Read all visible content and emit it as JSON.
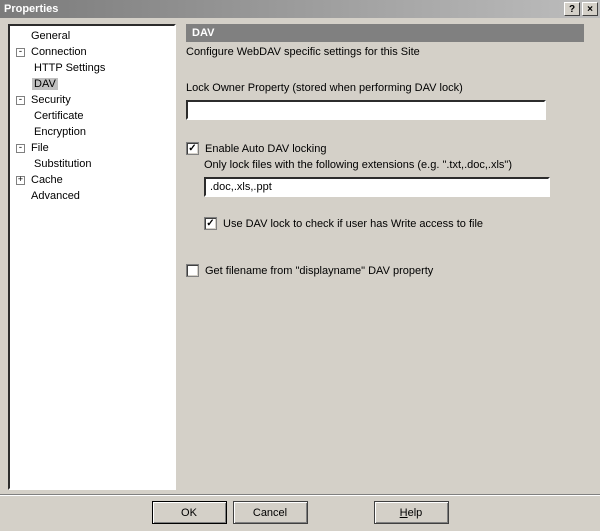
{
  "window": {
    "title": "Properties"
  },
  "tree": {
    "general": "General",
    "connection": "Connection",
    "http_settings": "HTTP Settings",
    "dav": "DAV",
    "security": "Security",
    "certificate": "Certificate",
    "encryption": "Encryption",
    "file": "File",
    "substitution": "Substitution",
    "cache": "Cache",
    "advanced": "Advanced"
  },
  "panel": {
    "header": "DAV",
    "description": "Configure WebDAV specific settings for this Site",
    "lock_owner_label": "Lock Owner Property (stored when performing DAV lock)",
    "lock_owner_value": "",
    "auto_lock_label": "Enable Auto DAV locking",
    "auto_lock_checked": true,
    "ext_label": "Only lock files with the following extensions (e.g. \".txt,.doc,.xls\")",
    "ext_value": ".doc,.xls,.ppt",
    "write_check_label": "Use DAV lock to check if user has Write access to file",
    "write_check_checked": true,
    "displayname_label": "Get filename from \"displayname\" DAV property",
    "displayname_checked": false
  },
  "buttons": {
    "ok": "OK",
    "cancel": "Cancel",
    "help": "Help"
  }
}
